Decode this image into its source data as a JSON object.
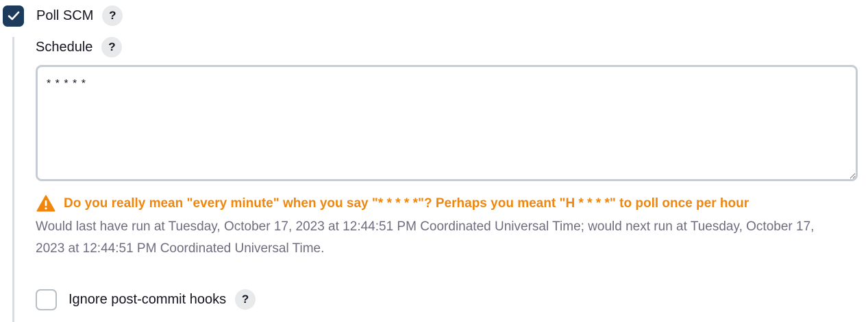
{
  "poll_scm": {
    "label": "Poll SCM",
    "checked": true,
    "help": "?"
  },
  "schedule": {
    "label": "Schedule",
    "help": "?",
    "value": "* * * * *"
  },
  "warning": {
    "icon": "warning-triangle-icon",
    "color": "#f0860c",
    "text": "Do you really mean \"every minute\" when you say \"* * * * *\"? Perhaps you meant \"H * * * *\" to poll once per hour"
  },
  "info": {
    "text": "Would last have run at Tuesday, October 17, 2023 at 12:44:51 PM Coordinated Universal Time; would next run at Tuesday, October 17, 2023 at 12:44:51 PM Coordinated Universal Time."
  },
  "ignore_hooks": {
    "label": "Ignore post-commit hooks",
    "checked": false,
    "help": "?"
  },
  "colors": {
    "checkbox_checked": "#1d3b5c",
    "info_text": "#6e6d80"
  }
}
